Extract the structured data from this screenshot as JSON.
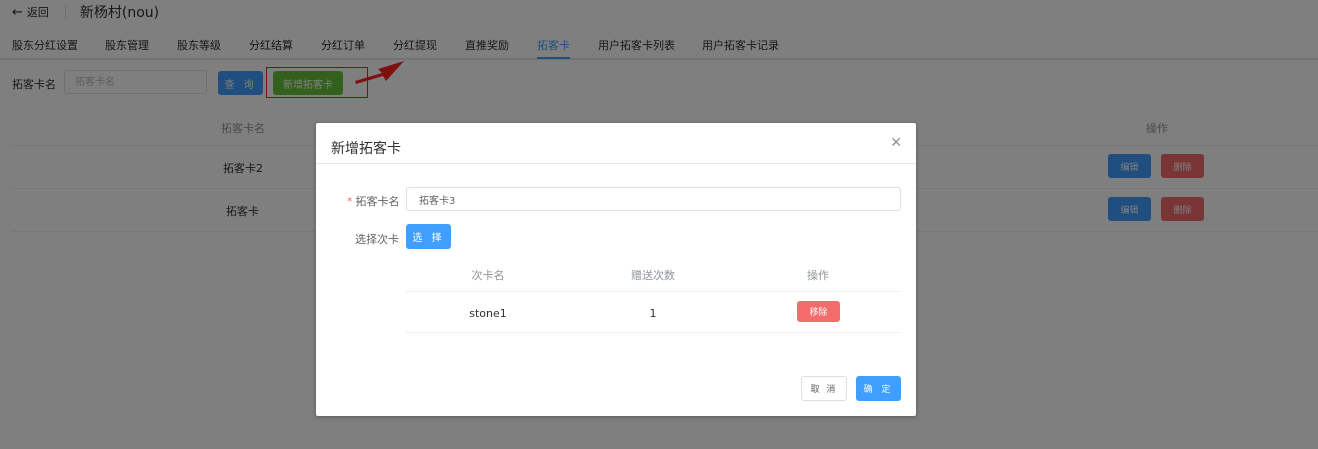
{
  "header": {
    "back_label": "返回",
    "page_title": "新杨村(nou)"
  },
  "tabs": [
    {
      "label": "股东分红设置"
    },
    {
      "label": "股东管理"
    },
    {
      "label": "股东等级"
    },
    {
      "label": "分红结算"
    },
    {
      "label": "分红订单"
    },
    {
      "label": "分红提现"
    },
    {
      "label": "直推奖励"
    },
    {
      "label": "拓客卡"
    },
    {
      "label": "用户拓客卡列表"
    },
    {
      "label": "用户拓客卡记录"
    }
  ],
  "active_tab": "拓客卡",
  "search": {
    "label": "拓客卡名",
    "placeholder": "拓客卡名",
    "query_button": "查 询",
    "add_button": "新增拓客卡"
  },
  "table": {
    "columns": [
      "拓客卡名",
      "",
      "操作"
    ],
    "rows": [
      {
        "name": "拓客卡2",
        "edit": "编辑",
        "delete": "删除"
      },
      {
        "name": "拓客卡",
        "edit": "编辑",
        "delete": "删除"
      }
    ]
  },
  "dialog": {
    "title": "新增拓客卡",
    "name_label": "拓客卡名",
    "name_value": "拓客卡3",
    "select_label": "选择次卡",
    "select_button": "选 择",
    "inner_table": {
      "columns": [
        "次卡名",
        "赠送次数",
        "操作"
      ],
      "rows": [
        {
          "card_name": "stone1",
          "count": "1",
          "action": "移除"
        }
      ]
    },
    "cancel_button": "取 消",
    "ok_button": "确 定"
  },
  "colors": {
    "primary": "#409eff",
    "success": "#67c23a",
    "danger": "#f56c6c",
    "annotation": "#ff2020"
  },
  "icons": {
    "back": "arrow-left-icon",
    "close": "close-icon"
  }
}
